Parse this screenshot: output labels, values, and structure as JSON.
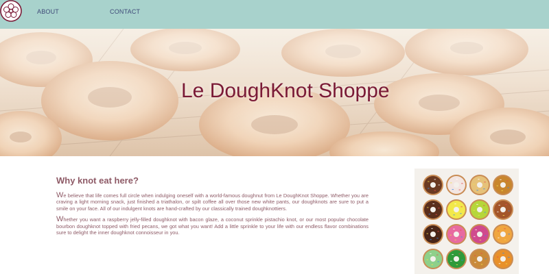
{
  "nav": {
    "logo_icon": "donut-logo-icon",
    "about_label": "ABOUT",
    "contact_label": "CONTACT",
    "background": "#a8d2cc",
    "link_color": "#3f4a78"
  },
  "hero": {
    "title": "Le DoughKnot Shoppe",
    "title_color": "#7a1a36"
  },
  "main": {
    "heading": "Why knot eat here?",
    "paragraphs": [
      {
        "first_letter": "W",
        "rest": "e believe that life comes full circle when indulging oneself with a world-famous doughnut from Le DoughKnot Shoppe. Whether you are craving a light morning snack, just finished a triathalon, or spilt coffee all over those new white pants, our doughknots are sure to put a smile on your face. All of our indulgent knots are hand-crafted by our classically trained doughknottiers."
      },
      {
        "first_letter": "W",
        "rest": "hether you want a raspberry jelly-filled doughknot with bacon glaze, a coconut sprinkle pistachio knot, or our most popular chocolate bourbon doughknot topped with fried pecans, we got what you want! Add a little sprinkle to your life with our endless flavor combinations sure to delight the inner doughknot connoisseur in you."
      }
    ],
    "text_color": "#8e5a66"
  }
}
